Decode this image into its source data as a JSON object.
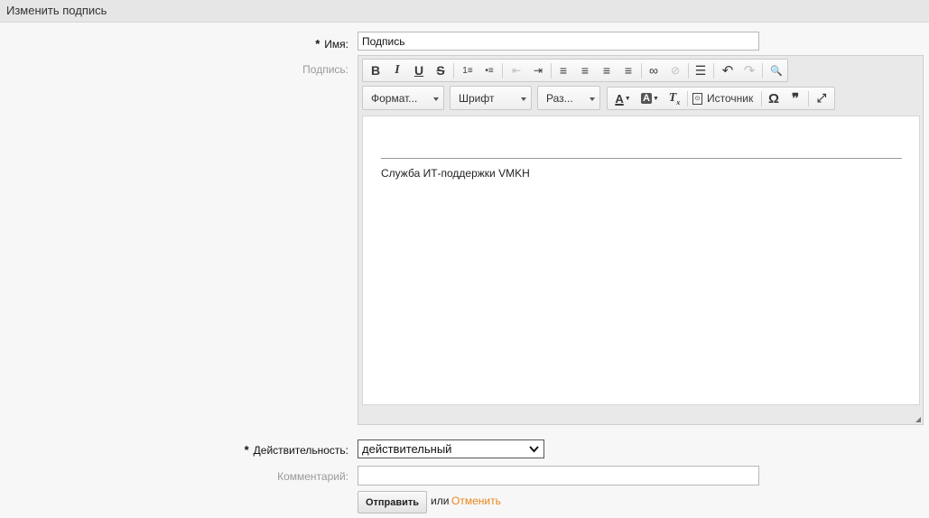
{
  "header": {
    "title": "Изменить подпись"
  },
  "form": {
    "name": {
      "label": "Имя:",
      "required": true,
      "value": "Подпись"
    },
    "signature": {
      "label": "Подпись:"
    },
    "validity": {
      "label": "Действительность:",
      "required": true,
      "value": "действительный"
    },
    "comment": {
      "label": "Комментарий:",
      "value": ""
    },
    "submit_label": "Отправить",
    "or_text": "или",
    "cancel_label": "Отменить"
  },
  "editor": {
    "toolbar_row1": [
      {
        "name": "bold",
        "glyph": "B"
      },
      {
        "name": "italic",
        "glyph": "I"
      },
      {
        "name": "underline",
        "glyph": "U"
      },
      {
        "name": "strikethrough",
        "glyph": "S"
      },
      {
        "name": "numbered-list",
        "glyph": "1≡"
      },
      {
        "name": "bulleted-list",
        "glyph": "•≡"
      },
      {
        "name": "decrease-indent",
        "glyph": "⇤"
      },
      {
        "name": "increase-indent",
        "glyph": "⇥"
      },
      {
        "name": "align-left",
        "glyph": "≡"
      },
      {
        "name": "align-center",
        "glyph": "≡"
      },
      {
        "name": "align-right",
        "glyph": "≡"
      },
      {
        "name": "justify",
        "glyph": "≡"
      },
      {
        "name": "link",
        "glyph": "∞"
      },
      {
        "name": "unlink",
        "glyph": "⊘"
      },
      {
        "name": "horizontal-line",
        "glyph": "☰"
      },
      {
        "name": "undo",
        "glyph": "↶"
      },
      {
        "name": "redo",
        "glyph": "↷"
      },
      {
        "name": "find",
        "glyph": "🔍"
      }
    ],
    "format_combo": "Формат...",
    "font_combo": "Шрифт",
    "size_combo": "Раз...",
    "source_label": "Источник",
    "content": {
      "signature_text": "Служба ИТ-поддержки VMKH"
    }
  },
  "colors": {
    "accent_link": "#e8861c",
    "header_bg": "#e6e6e6",
    "page_bg": "#f7f7f7"
  }
}
